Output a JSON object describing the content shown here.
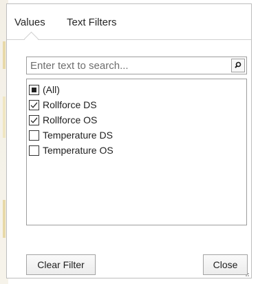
{
  "tabs": [
    {
      "label": "Values",
      "selected": true
    },
    {
      "label": "Text Filters",
      "selected": false
    }
  ],
  "search": {
    "value": "",
    "placeholder": "Enter text to search..."
  },
  "list": {
    "items": [
      {
        "label": "(All)",
        "state": "indeterminate"
      },
      {
        "label": "Rollforce DS",
        "state": "checked"
      },
      {
        "label": "Rollforce OS",
        "state": "checked"
      },
      {
        "label": "Temperature DS",
        "state": "unchecked"
      },
      {
        "label": "Temperature OS",
        "state": "unchecked"
      }
    ]
  },
  "buttons": {
    "clear_label": "Clear Filter",
    "close_label": "Close"
  },
  "icons": {
    "search": "magnifier-icon",
    "checkbox_checked": "check-icon",
    "checkbox_indeterminate": "square-fill-icon",
    "resize": "resize-grip-icon"
  }
}
